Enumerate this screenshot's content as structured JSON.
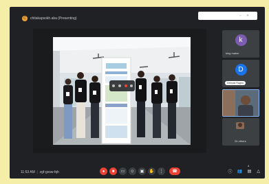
{
  "presenter": {
    "initial": "C",
    "label": "chitakapsokh.aba (Presenting)"
  },
  "tiles": [
    {
      "initial": "k",
      "name": "king maker",
      "color": "#7c5cb0"
    },
    {
      "initial": "D",
      "name": "Deepak Raghu",
      "color": "#1a73e8"
    },
    {
      "name": ""
    },
    {
      "name": "24 others"
    }
  ],
  "bottom": {
    "time": "11:53 AM",
    "meeting_code": "zgf-gxsw-fqh",
    "participant_count": "4"
  },
  "controls": [
    "mic-off",
    "camera-off",
    "captions",
    "emoji",
    "present",
    "raise-hand",
    "more",
    "hang-up"
  ],
  "right_controls": [
    "info",
    "people",
    "chat",
    "activities"
  ]
}
